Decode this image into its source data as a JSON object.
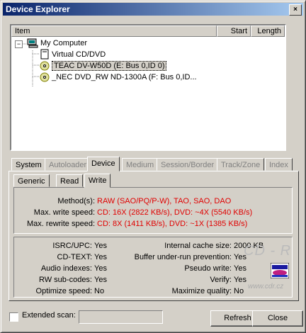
{
  "window": {
    "title": "Device Explorer",
    "close_glyph": "×"
  },
  "list": {
    "columns": [
      "Item",
      "Start",
      "Length"
    ],
    "root": {
      "label": "My Computer",
      "expander": "−"
    },
    "children": [
      {
        "label": "Virtual CD/DVD",
        "icon": "cd-icon"
      },
      {
        "label": "TEAC DV-W50D (E: Bus 0,ID 0)",
        "icon": "cd-drive-icon",
        "selected": true
      },
      {
        "label": "_NEC DVD_RW ND-1300A (F: Bus 0,ID...",
        "icon": "cd-drive-icon"
      }
    ]
  },
  "tabs": [
    {
      "label": "System",
      "disabled": false
    },
    {
      "label": "Autoloader",
      "disabled": true
    },
    {
      "label": "Device",
      "disabled": false,
      "active": true
    },
    {
      "label": "Medium",
      "disabled": true
    },
    {
      "label": "Session/Border",
      "disabled": true
    },
    {
      "label": "Track/Zone",
      "disabled": true
    },
    {
      "label": "Index",
      "disabled": true
    }
  ],
  "subtabs": [
    {
      "label": "Generic"
    },
    {
      "label": "Read"
    },
    {
      "label": "Write",
      "active": true
    }
  ],
  "write_info": [
    {
      "label": "Method(s):",
      "value": "RAW (SAO/PQ/P-W), TAO, SAO, DAO"
    },
    {
      "label": "Max. write speed:",
      "value": "CD: 16X (2822 KB/s), DVD: ~4X (5540 KB/s)"
    },
    {
      "label": "Max. rewrite speed:",
      "value": "CD: 8X (1411 KB/s), DVD: ~1X (1385 KB/s)"
    }
  ],
  "features_left": [
    {
      "label": "ISRC/UPC:",
      "value": "Yes"
    },
    {
      "label": "CD-TEXT:",
      "value": "Yes"
    },
    {
      "label": "Audio indexes:",
      "value": "Yes"
    },
    {
      "label": "RW sub-codes:",
      "value": "Yes"
    },
    {
      "label": "Optimize speed:",
      "value": "No"
    }
  ],
  "features_right": [
    {
      "label": "Internal cache size:",
      "value": "2000 KB"
    },
    {
      "label": "Buffer under-run prevention:",
      "value": "Yes"
    },
    {
      "label": "Pseudo write:",
      "value": "Yes"
    },
    {
      "label": "Verify:",
      "value": "Yes"
    },
    {
      "label": "Maximize quality:",
      "value": "No"
    }
  ],
  "watermark": {
    "logo_text": "CD - R",
    "url": "www.cdr.cz"
  },
  "footer": {
    "extended_scan_label": "Extended scan:",
    "extended_scan_checked": false,
    "refresh_label": "Refresh",
    "close_label": "Close"
  }
}
